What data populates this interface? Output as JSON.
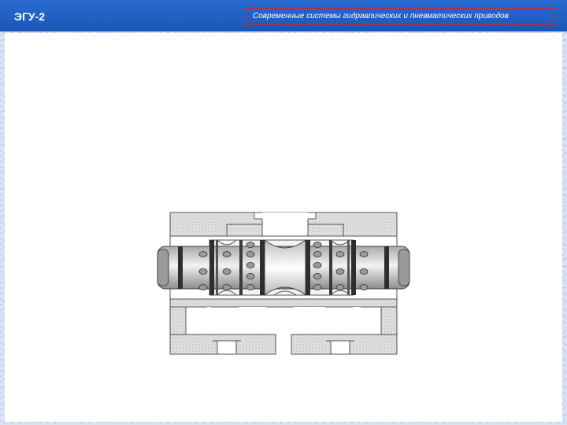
{
  "header": {
    "title": "ЭГУ-2",
    "subtitle": "Современные системы гидравлических и пневматических приводов"
  },
  "colors": {
    "header_bar": "#1f5fc4",
    "subtitle_border": "#e02020",
    "background": "#ffffff",
    "hatch": "#d4d4d4",
    "spool": "#c8c8c8"
  },
  "diagram": {
    "icon": "hydraulic-spool-valve-cross-section"
  }
}
